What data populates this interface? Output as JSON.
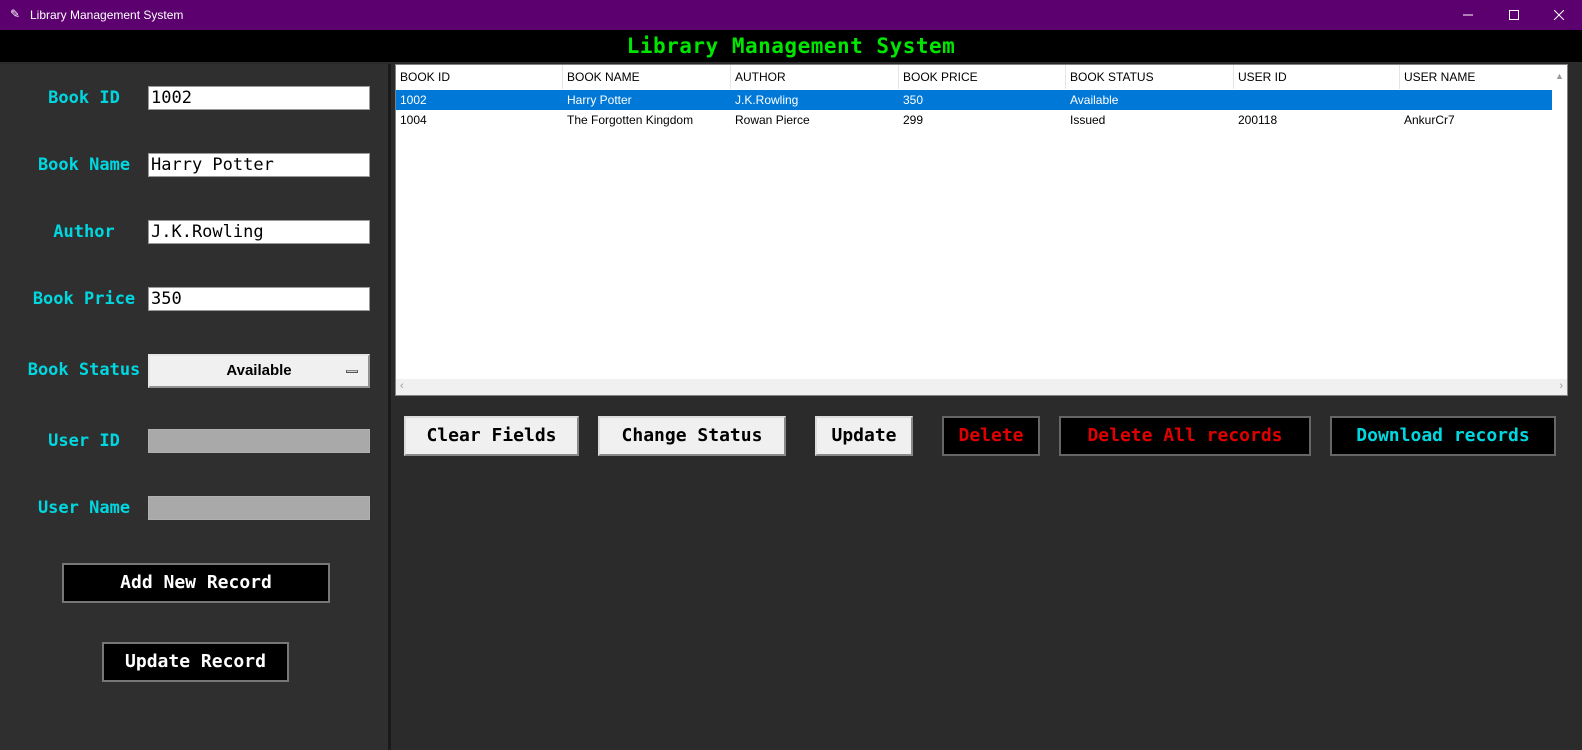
{
  "window": {
    "title": "Library Management System",
    "controls": {
      "minimize": "—",
      "maximize": "☐",
      "close": "✕"
    }
  },
  "header": {
    "title": "Library Management System"
  },
  "form": {
    "book_id": {
      "label": "Book ID",
      "value": "1002"
    },
    "book_name": {
      "label": "Book Name",
      "value": "Harry Potter"
    },
    "author": {
      "label": "Author",
      "value": "J.K.Rowling"
    },
    "book_price": {
      "label": "Book Price",
      "value": "350"
    },
    "book_status": {
      "label": "Book Status",
      "value": "Available"
    },
    "user_id": {
      "label": "User ID",
      "value": ""
    },
    "user_name": {
      "label": "User Name",
      "value": ""
    },
    "add_button": "Add New Record",
    "update_button": "Update Record"
  },
  "table": {
    "columns": [
      "BOOK ID",
      "BOOK NAME",
      "AUTHOR",
      "BOOK PRICE",
      "BOOK STATUS",
      "USER ID",
      "USER NAME"
    ],
    "rows": [
      [
        "1002",
        "Harry Potter",
        "J.K.Rowling",
        "350",
        "Available",
        "",
        ""
      ],
      [
        "1004",
        "The Forgotten Kingdom",
        "Rowan Pierce",
        "299",
        "Issued",
        "200118",
        "AnkurCr7"
      ]
    ],
    "selected_row": 0
  },
  "actions": {
    "clear": "Clear Fields",
    "change_status": "Change Status",
    "update": "Update",
    "delete": "Delete",
    "delete_all": "Delete All records",
    "download": "Download records"
  },
  "colors": {
    "titlebar": "#5b006e",
    "heading_text": "#00e600",
    "label_text": "#00d7e0",
    "danger_text": "#e00000",
    "selection": "#0078d7"
  }
}
